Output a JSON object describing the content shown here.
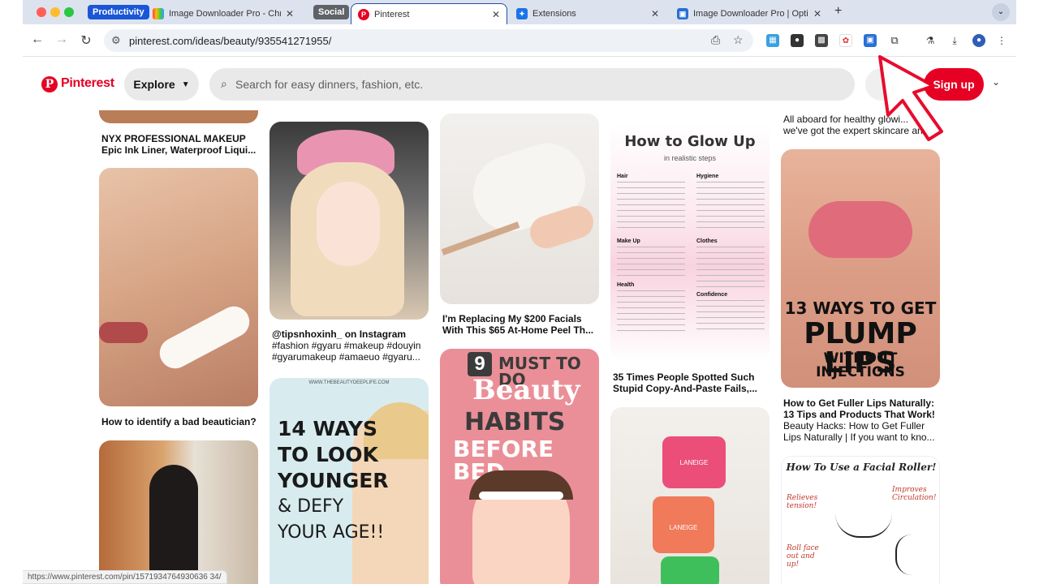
{
  "browser": {
    "tab_groups": [
      {
        "label": "Productivity",
        "color": "#1a56d6"
      },
      {
        "label": "Social",
        "color": "#5f6368"
      }
    ],
    "tabs": [
      {
        "title": "Image Downloader Pro - Chro",
        "favicon": "rainbow-icon"
      },
      {
        "title": "Pinterest",
        "favicon": "pinterest-icon",
        "active": true
      },
      {
        "title": "Extensions",
        "favicon": "puzzle-icon"
      },
      {
        "title": "Image Downloader Pro | Optic",
        "favicon": "image-downloader-icon"
      }
    ],
    "url": "pinterest.com/ideas/beauty/935541271955/",
    "status_url": "https://www.pinterest.com/pin/1571934764930636 34/"
  },
  "pinterest": {
    "brand": "Pinterest",
    "explore_label": "Explore",
    "search_placeholder": "Search for easy dinners, fashion, etc.",
    "signup_label": "Sign up",
    "accent": "#e60023"
  },
  "pins": {
    "col1": [
      {
        "title": "NYX PROFESSIONAL MAKEUP",
        "subtitle": "Epic Ink Liner, Waterproof Liqui..."
      },
      {
        "title": "How to identify a bad beautician?"
      }
    ],
    "col2": [
      {
        "title": "@tipsnhoxinh_ on Instagram",
        "subtitle_1": "#fashion #gyaru #makeup #douyin",
        "subtitle_2": "#gyarumakeup #amaeuo #gyaru..."
      },
      {
        "poster_line1": "14 WAYS",
        "poster_line2": "TO LOOK",
        "poster_line3": "YOUNGER",
        "poster_line4": "& DEFY",
        "poster_line5": "YOUR AGE!!",
        "watermark": "WWW.THEBEAUTYDEEPLIFE.COM"
      }
    ],
    "col3": [
      {
        "title": "I'm Replacing My $200 Facials",
        "subtitle": "With This $65 At-Home Peel Th..."
      },
      {
        "badge": "9",
        "poster_line1": "MUST TO DO",
        "poster_line2": "Beauty",
        "poster_line3": "HABITS",
        "poster_line4": "BEFORE BED"
      }
    ],
    "col4": [
      {
        "poster_title": "How to Glow Up",
        "poster_sub": "in realistic steps",
        "sections": [
          "Hair",
          "Hygiene",
          "Make Up",
          "Clothes",
          "Health",
          "Confidence"
        ],
        "title": "35 Times People Spotted Such",
        "subtitle": "Stupid Copy-And-Paste Fails,..."
      },
      {
        "product_label_1": "LANEIGE",
        "product_label_2": "LANEIGE"
      }
    ],
    "col5": [
      {
        "title": "All aboard for healthy glowi...",
        "subtitle": "we've got the expert skincare and..."
      },
      {
        "poster_line1": "13 WAYS TO GET",
        "poster_line2": "PLUMP LIPS",
        "poster_line3": "WITHOUT INJECTIONS",
        "title_1": "How to Get Fuller Lips Naturally:",
        "title_2": "13 Tips and Products That Work!",
        "subtitle_1": "Beauty Hacks: How to Get Fuller",
        "subtitle_2": "Lips Naturally | If you want to kno..."
      },
      {
        "poster_title": "How To Use a Facial Roller!",
        "note_1": "Relieves tension!",
        "note_2": "Improves Circulation!",
        "note_3": "Roll face out and up!"
      }
    ]
  }
}
